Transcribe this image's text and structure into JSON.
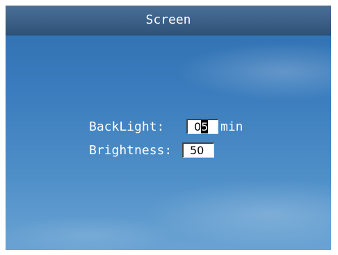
{
  "window": {
    "title": "Screen"
  },
  "settings": {
    "backlight": {
      "label": "BackLight:",
      "value_prefix": "0",
      "value_cursor": "5",
      "unit": "min"
    },
    "brightness": {
      "label": "Brightness:",
      "value": "50"
    }
  },
  "colors": {
    "titlebar": "#3b5f86",
    "background": "#3a7cbd",
    "text": "#ffffff",
    "field": "#ffffff"
  }
}
